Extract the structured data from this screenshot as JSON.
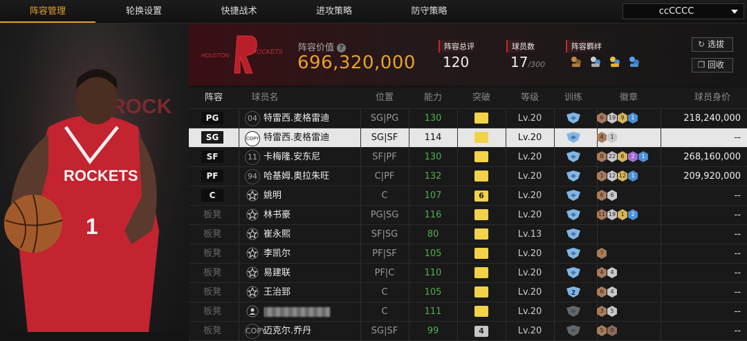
{
  "nav": {
    "tabs": [
      "阵容管理",
      "轮换设置",
      "快捷战术",
      "进攻策略",
      "防守策略"
    ],
    "user": "ccCCCC"
  },
  "team": {
    "logo_text_left": "HOUSTON",
    "logo_text_right": "ROCKETS",
    "value_label": "阵容价值",
    "value": "696,320,000",
    "rating_label": "阵容总评",
    "rating": "120",
    "players_label": "球员数",
    "players": "17",
    "players_max": "/300",
    "bonds_label": "阵容羁绊",
    "bond_icons": [
      "bond-icon-1",
      "bond-icon-2",
      "bond-icon-3",
      "bond-icon-4"
    ]
  },
  "buttons": {
    "select": "选拔",
    "recycle": "回收"
  },
  "art": {
    "jersey_text": "ROCKETS",
    "jersey_number": "1",
    "backdrop_text": "ROCK"
  },
  "columns": [
    "阵容",
    "球员名",
    "位置",
    "能力",
    "突破",
    "等级",
    "训练",
    "徽章",
    "球员身价"
  ],
  "rows": [
    {
      "role": "PG",
      "num": "04",
      "name": "特雷西.麦格雷迪",
      "pos": "SG|PG",
      "ability": "130",
      "break": "",
      "level": "Lv.20",
      "train": "",
      "badges": [
        [
          "6",
          "b"
        ],
        [
          "19",
          "s"
        ],
        [
          "9",
          "g"
        ],
        [
          "1",
          "bl"
        ]
      ],
      "value": "218,240,000"
    },
    {
      "role": "SG",
      "num": "COPY",
      "name": "特雷西.麦格雷迪",
      "pos": "SG|SF",
      "ability": "114",
      "break": "",
      "level": "Lv.20",
      "train": "",
      "badges": [
        [
          "4",
          "b"
        ],
        [
          "1",
          "s"
        ]
      ],
      "value": "--"
    },
    {
      "role": "SF",
      "num": "11",
      "name": "卡梅隆.安东尼",
      "pos": "SF|PF",
      "ability": "130",
      "break": "",
      "level": "Lv.20",
      "train": "",
      "badges": [
        [
          "8",
          "b"
        ],
        [
          "22",
          "s"
        ],
        [
          "6",
          "g"
        ],
        [
          "2",
          "p"
        ],
        [
          "1",
          "bl"
        ]
      ],
      "value": "268,160,000"
    },
    {
      "role": "PF",
      "num": "94",
      "name": "哈基姆.奥拉朱旺",
      "pos": "C|PF",
      "ability": "132",
      "break": "",
      "level": "Lv.20",
      "train": "",
      "badges": [
        [
          "1",
          "b"
        ],
        [
          "12",
          "s"
        ],
        [
          "12",
          "g"
        ],
        [
          "1",
          "bl"
        ]
      ],
      "value": "209,920,000"
    },
    {
      "role": "C",
      "num": "star",
      "name": "姚明",
      "pos": "C",
      "ability": "107",
      "break": "6",
      "level": "Lv.20",
      "train": "",
      "badges": [
        [
          "6",
          "b"
        ],
        [
          "6",
          "s"
        ]
      ],
      "value": "--"
    },
    {
      "role": "板凳",
      "num": "star",
      "name": "林书豪",
      "pos": "PG|SG",
      "ability": "116",
      "break": "",
      "level": "Lv.20",
      "train": "",
      "badges": [
        [
          "11",
          "b"
        ],
        [
          "19",
          "s"
        ],
        [
          "1",
          "g"
        ],
        [
          "2",
          "bl"
        ]
      ],
      "value": "--"
    },
    {
      "role": "板凳",
      "num": "star",
      "name": "崔永熙",
      "pos": "SF|SG",
      "ability": "80",
      "break": "",
      "level": "Lv.13",
      "train": "",
      "badges": [],
      "value": "--"
    },
    {
      "role": "板凳",
      "num": "star",
      "name": "李凯尔",
      "pos": "PF|SF",
      "ability": "105",
      "break": "",
      "level": "Lv.20",
      "train": "",
      "badges": [
        [
          "7",
          "b"
        ]
      ],
      "value": "--"
    },
    {
      "role": "板凳",
      "num": "star",
      "name": "易建联",
      "pos": "PF|C",
      "ability": "110",
      "break": "",
      "level": "Lv.20",
      "train": "",
      "badges": [
        [
          "4",
          "b"
        ],
        [
          "4",
          "s"
        ]
      ],
      "value": "--"
    },
    {
      "role": "板凳",
      "num": "star",
      "name": "王治郅",
      "pos": "C",
      "ability": "105",
      "break": "",
      "level": "Lv.20",
      "train": "2",
      "badges": [
        [
          "6",
          "b"
        ],
        [
          "4",
          "s"
        ]
      ],
      "value": "--"
    },
    {
      "role": "板凳",
      "num": "person",
      "name": "",
      "pos": "C",
      "ability": "111",
      "break": "",
      "level": "Lv.20",
      "train": "gray",
      "badges": [
        [
          "3",
          "b"
        ],
        [
          "5",
          "s"
        ]
      ],
      "value": "--"
    },
    {
      "role": "板凳",
      "num": "COPY",
      "name": "迈克尔.乔丹",
      "pos": "SG|SF",
      "ability": "99",
      "break": "4",
      "level": "Lv.20",
      "train": "gray",
      "badges": [
        [
          "5",
          "b"
        ],
        [
          "0",
          "d"
        ]
      ],
      "value": "--"
    }
  ],
  "colors": {
    "accent": "#e2a22c",
    "value": "#e8a22c",
    "ability": "#4faf4f",
    "red": "#c8242c"
  }
}
